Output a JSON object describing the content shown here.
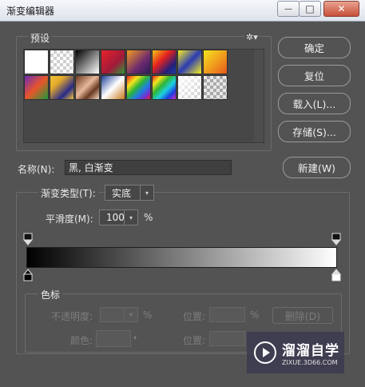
{
  "window": {
    "title": "渐变编辑器",
    "minimize_glyph": "—",
    "maximize_glyph": "□",
    "close_glyph": "✕"
  },
  "presets": {
    "label": "预设",
    "gear_glyph": "✲▾",
    "swatches_row1": [
      {
        "css": "#ffffff"
      },
      {
        "css": "checker-white"
      },
      {
        "css": "linear-gradient(135deg,#000 0%,#fff 100%)"
      },
      {
        "css": "linear-gradient(135deg,#e8232a 0%,#a01a3a 60%,#2e9a36 100%)"
      },
      {
        "css": "linear-gradient(135deg,#f49a22 0%,#6c2a6e 60%,#2b1d57 100%)"
      },
      {
        "css": "linear-gradient(135deg,#f6c516 0%,#e4211f 40%,#251f7a 75%,#1b3fa8 100%)"
      },
      {
        "css": "linear-gradient(135deg,#f8ef22 0%,#2b3cb3 50%,#f8ef22 100%)"
      },
      {
        "css": "linear-gradient(135deg,#f4e51d 0%,#f09a1e 55%,#e4571b 100%)"
      }
    ],
    "swatches_row2": [
      {
        "css": "linear-gradient(135deg,#6c2bb6 0%,#e8562a 50%,#1f9a3a 100%)"
      },
      {
        "css": "linear-gradient(135deg,#f0c23a 0%,#e4aa2b 30%,#2a2a88 70%,#f0c23a 100%)"
      },
      {
        "css": "linear-gradient(135deg,#6b3a22 0%,#e8b89a 45%,#6b3a22 70%,#f4d8c0 100%)"
      },
      {
        "css": "linear-gradient(135deg,#1d3f9a 0%,#ffffff 50%,#c67a1d 100%)"
      },
      {
        "css": "linear-gradient(135deg,#e8231f 0%,#f4e51d 25%,#2fb536 45%,#1d7fe0 65%,#7a2ad0 85%,#e8231f 100%)"
      },
      {
        "css": "linear-gradient(135deg,#e8231f 0%,#f4e51d 20%,#2fb536 40%,#1dd0e0 60%,#1d3fe0 80%,#d02ac4 100%)"
      },
      {
        "css": "checker-light"
      },
      {
        "css": "checker-dark"
      }
    ]
  },
  "buttons": {
    "ok": "确定",
    "reset": "复位",
    "load": "载入(L)...",
    "save": "存储(S)...",
    "new": "新建(W)"
  },
  "name_field": {
    "label": "名称(N):",
    "value": "黑, 白渐变"
  },
  "gradient_type": {
    "label": "渐变类型(T):",
    "value": "实底",
    "arrow": "▾"
  },
  "smoothness": {
    "label": "平滑度(M):",
    "value": "100",
    "arrow": "▾",
    "unit": "%"
  },
  "colors": {
    "start": "#000000",
    "end": "#ffffff"
  },
  "color_stops": {
    "legend": "色标",
    "opacity_label": "不透明度:",
    "opacity_unit": "%",
    "position_label": "位置:",
    "position_unit": "%",
    "delete_label": "删除(D)",
    "color_label": "颜色:",
    "position_label_2": "位置:",
    "arrow": "▾"
  },
  "watermark": {
    "brand": "溜溜自学",
    "url": "ZIXUE.3D66.COM"
  }
}
